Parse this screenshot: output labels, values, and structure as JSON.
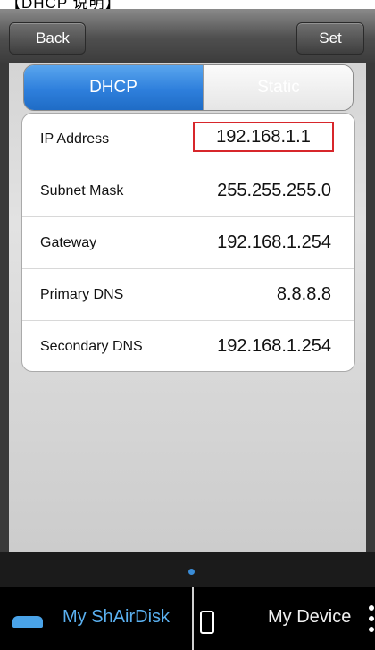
{
  "header": {
    "caption": "【DHCP 说明】"
  },
  "nav": {
    "back_label": "Back",
    "set_label": "Set"
  },
  "segment": {
    "dhcp_label": "DHCP",
    "static_label": "Static",
    "selected": "DHCP"
  },
  "network": {
    "rows": [
      {
        "label": "IP Address",
        "value": "192.168.1.1"
      },
      {
        "label": "Subnet Mask",
        "value": "255.255.255.0"
      },
      {
        "label": "Gateway",
        "value": "192.168.1.254"
      },
      {
        "label": "Primary DNS",
        "value": "8.8.8.8"
      },
      {
        "label": "Secondary DNS",
        "value": "192.168.1.254"
      }
    ]
  },
  "tabbar": {
    "tab1_label": "My ShAirDisk",
    "tab1_icon": "disk-icon",
    "tab2_label": "My Device",
    "tab2_icon": "phone-icon",
    "more_icon": "more-icon"
  },
  "colors": {
    "accent": "#2e7fdc",
    "highlight": "#d7262b",
    "tab_active": "#5ab0f0"
  }
}
